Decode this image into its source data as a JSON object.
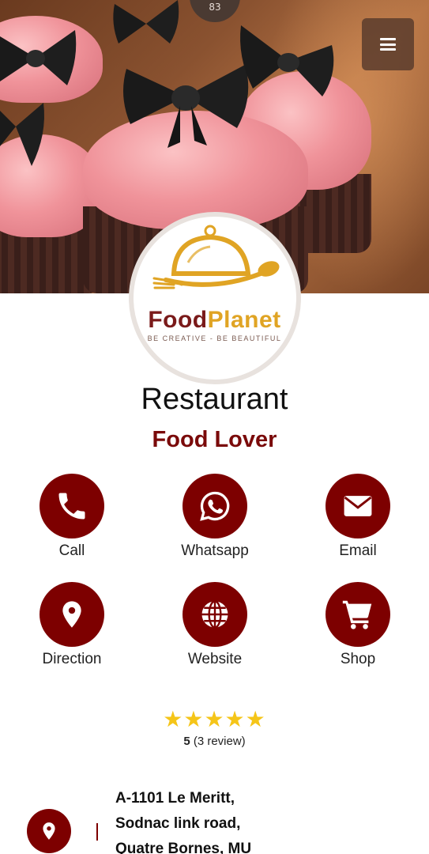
{
  "top": {
    "counter": "83"
  },
  "brand": {
    "name_part1": "Food",
    "name_part2": "Planet",
    "tagline": "BE CREATIVE - BE BEAUTIFUL"
  },
  "header": {
    "title": "Restaurant",
    "subtitle": "Food Lover"
  },
  "actions": [
    {
      "label": "Call",
      "icon": "phone-icon"
    },
    {
      "label": "Whatsapp",
      "icon": "whatsapp-icon"
    },
    {
      "label": "Email",
      "icon": "envelope-icon"
    },
    {
      "label": "Direction",
      "icon": "map-pin-icon"
    },
    {
      "label": "Website",
      "icon": "globe-icon"
    },
    {
      "label": "Shop",
      "icon": "shopping-cart-icon"
    }
  ],
  "rating": {
    "stars": "★★★★★",
    "score": "5",
    "reviews": "(3 review)"
  },
  "address": {
    "line1": "A-1101 Le Meritt,",
    "line2": "Sodnac link road,",
    "line3": "Quatre Bornes, MU"
  },
  "colors": {
    "accent": "#7d0000",
    "gold": "#e0a424",
    "star": "#f5c518"
  }
}
